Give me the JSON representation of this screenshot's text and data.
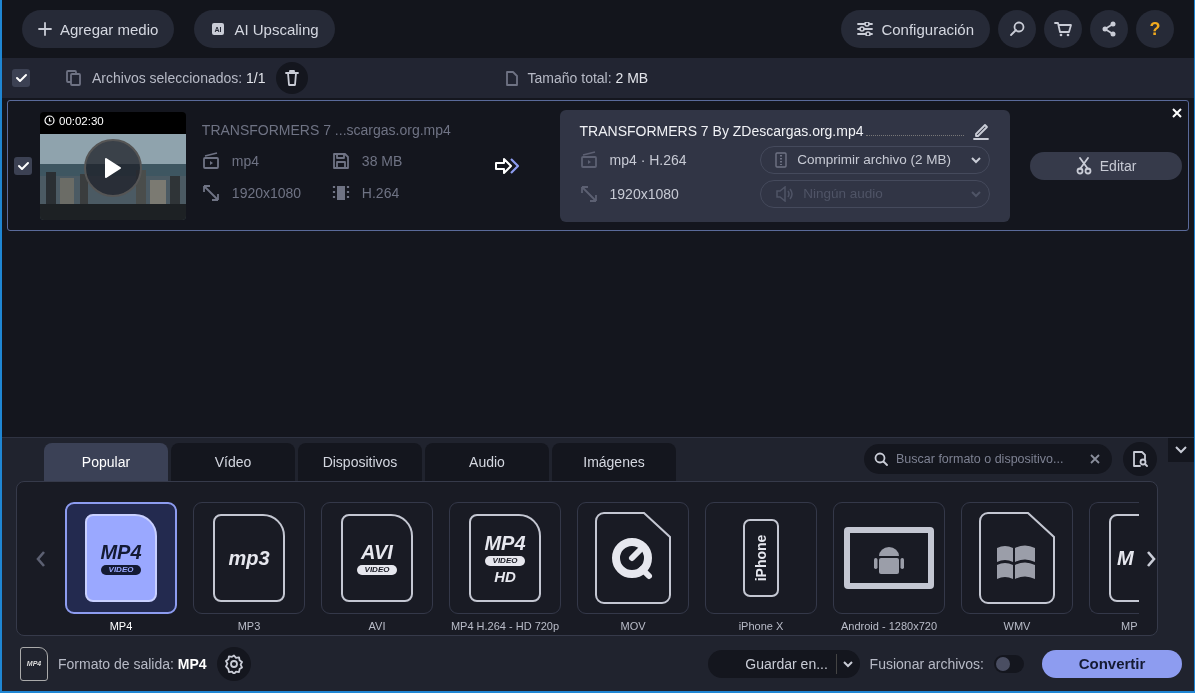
{
  "toolbar": {
    "buttons": [
      {
        "kind": "add",
        "label": "Agregar medio"
      },
      {
        "kind": "ai",
        "label": "AI Upscaling",
        "icon_text": "AI"
      }
    ],
    "settings": {
      "label": "Configuración"
    },
    "icon_buttons": [
      {
        "kind": "search"
      },
      {
        "kind": "cart"
      },
      {
        "kind": "share"
      },
      {
        "kind": "help",
        "label": "?"
      }
    ]
  },
  "selection_bar": {
    "checked": true,
    "selected_label": "Archivos seleccionados:",
    "selected_count": "1/1",
    "total_label": "Tamaño total:",
    "total_value": "2 MB"
  },
  "files": [
    {
      "checked": true,
      "duration": "00:02:30",
      "source_name": "TRANSFORMERS 7 ...scargas.org.mp4",
      "source_format": "mp4",
      "source_size": "38 MB",
      "source_resolution": "1920x1080",
      "source_codec": "H.264",
      "output_name": "TRANSFORMERS 7 By ZDescargas.org.mp4",
      "output_format": "mp4 · H.264",
      "output_resolution": "1920x1080",
      "compress": "Comprimir archivo (2 MB)",
      "audio": "Ningún audio",
      "audio_disabled": true,
      "edit": "Editar"
    }
  ],
  "format_tabs": [
    {
      "label": "Popular",
      "selected": true
    },
    {
      "label": "Vídeo",
      "selected": false
    },
    {
      "label": "Dispositivos",
      "selected": false
    },
    {
      "label": "Audio",
      "selected": false
    },
    {
      "label": "Imágenes",
      "selected": false
    }
  ],
  "search": {
    "placeholder": "Buscar formato o dispositivo..."
  },
  "formats": [
    {
      "kind": "file",
      "logo": [
        "MP4",
        "VIDEO"
      ],
      "label": "MP4",
      "selected": true
    },
    {
      "kind": "file",
      "logo": [
        "mp3"
      ],
      "label": "MP3",
      "selected": false
    },
    {
      "kind": "file",
      "logo": [
        "AVI",
        "VIDEO"
      ],
      "label": "AVI",
      "selected": false
    },
    {
      "kind": "file",
      "logo": [
        "MP4",
        "VIDEO",
        "HD"
      ],
      "label": "MP4 H.264 - HD 720p",
      "selected": false
    },
    {
      "kind": "quicktime",
      "label": "MOV",
      "selected": false
    },
    {
      "kind": "phone",
      "logo": [
        "iPhone"
      ],
      "label": "iPhone X",
      "selected": false
    },
    {
      "kind": "tablet",
      "label": "Android - 1280x720",
      "selected": false
    },
    {
      "kind": "windows",
      "label": "WMV",
      "selected": false
    },
    {
      "kind": "file",
      "logo": [
        "M"
      ],
      "label": "MP",
      "selected": false,
      "cut": true
    }
  ],
  "footer": {
    "format_icon_text": "MP4",
    "output_label": "Formato de salida:",
    "output_value": "MP4",
    "save": "Guardar en...",
    "merge_label": "Fusionar archivos:",
    "merge_on": false,
    "convert": "Convertir"
  }
}
